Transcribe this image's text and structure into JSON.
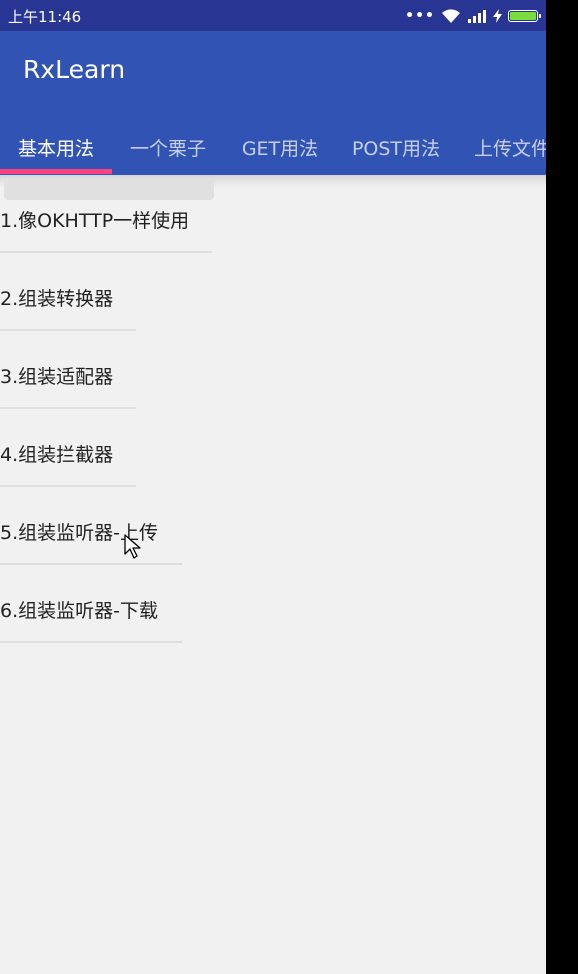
{
  "status_bar": {
    "time": "上午11:46",
    "icons": [
      "signal-dots-icon",
      "wifi-icon",
      "cellular-signal-icon",
      "charging-icon",
      "battery-icon"
    ],
    "battery_color": "#76dd3c"
  },
  "app_bar": {
    "title": "RxLearn",
    "color": "#3154b4"
  },
  "tabs": [
    {
      "label": "基本用法",
      "active": true
    },
    {
      "label": "一个栗子",
      "active": false
    },
    {
      "label": "GET用法",
      "active": false
    },
    {
      "label": "POST用法",
      "active": false
    },
    {
      "label": "上传文件",
      "active": false
    }
  ],
  "indicator_color": "#ff4081",
  "list": {
    "items": [
      {
        "label": "1.像OKHTTP一样使用"
      },
      {
        "label": "2.组装转换器"
      },
      {
        "label": "3.组装适配器"
      },
      {
        "label": "4.组装拦截器"
      },
      {
        "label": "5.组装监听器-上传"
      },
      {
        "label": "6.组装监听器-下载"
      }
    ]
  }
}
